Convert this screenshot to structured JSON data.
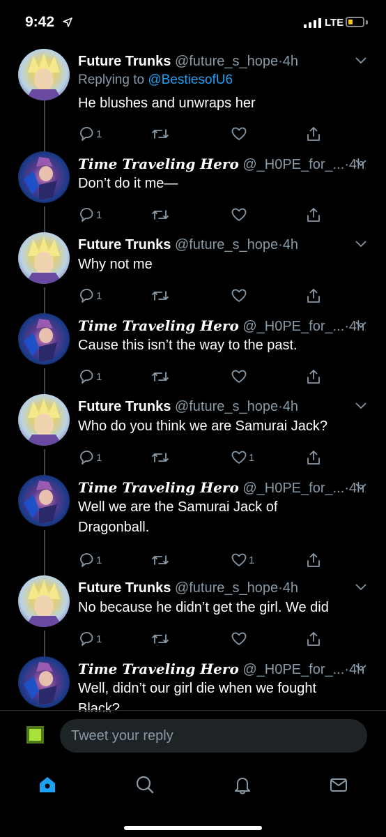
{
  "status_bar": {
    "time": "9:42",
    "network": "LTE",
    "battery_color": "#f5c518"
  },
  "colors": {
    "accent": "#1da1f2",
    "muted": "#8899a6",
    "background": "#000000"
  },
  "tweets": [
    {
      "author": "Future Trunks",
      "handle": "@future_s_hope",
      "time": "4h",
      "replying_prefix": "Replying to ",
      "replying_to": "@BestiesofU6",
      "text": "He blushes and unwraps her",
      "replies": "1",
      "retweets": "",
      "likes": ""
    },
    {
      "author": "Time Traveling Hero",
      "handle": "@_H0PE_for_...",
      "time": "4h",
      "text": "Don’t do it me—",
      "replies": "1",
      "retweets": "",
      "likes": ""
    },
    {
      "author": "Future Trunks",
      "handle": "@future_s_hope",
      "time": "4h",
      "text": "Why not me",
      "replies": "1",
      "retweets": "",
      "likes": ""
    },
    {
      "author": "Time Traveling Hero",
      "handle": "@_H0PE_for_...",
      "time": "4h",
      "text": "Cause this isn’t the way to the past.",
      "replies": "1",
      "retweets": "",
      "likes": ""
    },
    {
      "author": "Future Trunks",
      "handle": "@future_s_hope",
      "time": "4h",
      "text": "Who do you think we are Samurai Jack?",
      "replies": "1",
      "retweets": "",
      "likes": "1"
    },
    {
      "author": "Time Traveling Hero",
      "handle": "@_H0PE_for_...",
      "time": "4h",
      "text": "Well we are the Samurai Jack of Dragonball.",
      "replies": "1",
      "retweets": "",
      "likes": "1"
    },
    {
      "author": "Future Trunks",
      "handle": "@future_s_hope",
      "time": "4h",
      "text": "No because he didn’t get the girl. We did",
      "replies": "1",
      "retweets": "",
      "likes": ""
    },
    {
      "author": "Time Traveling Hero",
      "handle": "@_H0PE_for_...",
      "time": "4h",
      "text": "Well, didn’t our girl die when we fought Black?",
      "replies": "",
      "retweets": "",
      "likes": ""
    }
  ],
  "composer": {
    "placeholder": "Tweet your reply"
  },
  "tabs": [
    "home-icon",
    "search-icon",
    "notifications-icon",
    "messages-icon"
  ]
}
